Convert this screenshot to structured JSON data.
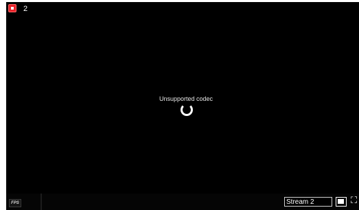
{
  "viewer": {
    "channel_number": "2",
    "status_message": "Unsupported codec",
    "recording_icon": "record-icon",
    "loading_icon": "spinner-icon"
  },
  "toolbar": {
    "fps_badge": "FPS",
    "stream_select": {
      "selected": "Stream 2"
    },
    "window_icon": "window-icon",
    "fullscreen_icon": "fullscreen-icon"
  },
  "colors": {
    "background": "#000000",
    "record_red": "#e8232a",
    "text": "#ffffff"
  }
}
